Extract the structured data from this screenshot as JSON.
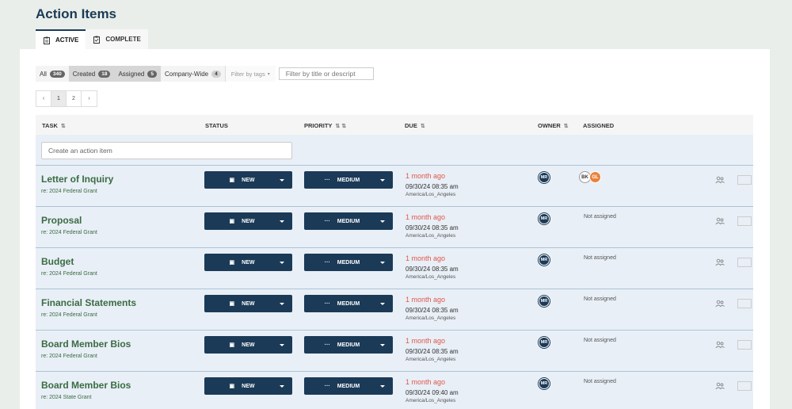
{
  "page": {
    "title": "Action Items"
  },
  "tabs": [
    {
      "label": "ACTIVE",
      "active": true,
      "icon": "clipboard-icon"
    },
    {
      "label": "COMPLETE",
      "active": false,
      "icon": "clipboard-check-icon"
    }
  ],
  "filters": [
    {
      "label": "All",
      "count": "340",
      "selected": false
    },
    {
      "label": "Created",
      "count": "18",
      "selected": true
    },
    {
      "label": "Assigned",
      "count": "5",
      "selected": true
    },
    {
      "label": "Company-Wide",
      "count": "4",
      "selected": false
    }
  ],
  "tag_filter": {
    "placeholder": "Filter by tags"
  },
  "search": {
    "placeholder": "Filter by title or descript"
  },
  "pagination": {
    "prev": "‹",
    "pages": [
      "1",
      "2"
    ],
    "current": "1",
    "next": "›"
  },
  "columns": {
    "task": "TASK",
    "status": "STATUS",
    "priority": "PRIORITY",
    "due": "DUE",
    "owner": "OWNER",
    "assigned": "ASSIGNED"
  },
  "create": {
    "placeholder": "Create an action item"
  },
  "rows": [
    {
      "name": "Letter of Inquiry",
      "re": "re: 2024 Federal Grant",
      "status": "NEW",
      "priority": "MEDIUM",
      "due_relative": "1 month ago",
      "due_date": "09/30/24 08:35 am",
      "due_tz": "America/Los_Angeles",
      "owner": "MR",
      "assigned_text": "",
      "assignees": [
        "BK",
        "GL"
      ]
    },
    {
      "name": "Proposal",
      "re": "re: 2024 Federal Grant",
      "status": "NEW",
      "priority": "MEDIUM",
      "due_relative": "1 month ago",
      "due_date": "09/30/24 08:35 am",
      "due_tz": "America/Los_Angeles",
      "owner": "MR",
      "assigned_text": "Not assigned",
      "assignees": []
    },
    {
      "name": "Budget",
      "re": "re: 2024 Federal Grant",
      "status": "NEW",
      "priority": "MEDIUM",
      "due_relative": "1 month ago",
      "due_date": "09/30/24 08:35 am",
      "due_tz": "America/Los_Angeles",
      "owner": "MR",
      "assigned_text": "Not assigned",
      "assignees": []
    },
    {
      "name": "Financial Statements",
      "re": "re: 2024 Federal Grant",
      "status": "NEW",
      "priority": "MEDIUM",
      "due_relative": "1 month ago",
      "due_date": "09/30/24 08:35 am",
      "due_tz": "America/Los_Angeles",
      "owner": "MR",
      "assigned_text": "Not assigned",
      "assignees": []
    },
    {
      "name": "Board Member Bios",
      "re": "re: 2024 Federal Grant",
      "status": "NEW",
      "priority": "MEDIUM",
      "due_relative": "1 month ago",
      "due_date": "09/30/24 08:35 am",
      "due_tz": "America/Los_Angeles",
      "owner": "MR",
      "assigned_text": "Not assigned",
      "assignees": []
    },
    {
      "name": "Board Member Bios",
      "re": "re: 2024 State Grant",
      "status": "NEW",
      "priority": "MEDIUM",
      "due_relative": "1 month ago",
      "due_date": "09/30/24 09:40 am",
      "due_tz": "America/Los_Angeles",
      "owner": "MR",
      "assigned_text": "Not assigned",
      "assignees": []
    }
  ],
  "colors": {
    "primary": "#1b3a57",
    "task_green": "#3b6b43",
    "overdue_red": "#e2574c",
    "row_bg": "#e8eff6",
    "accent_orange": "#e8823a"
  }
}
